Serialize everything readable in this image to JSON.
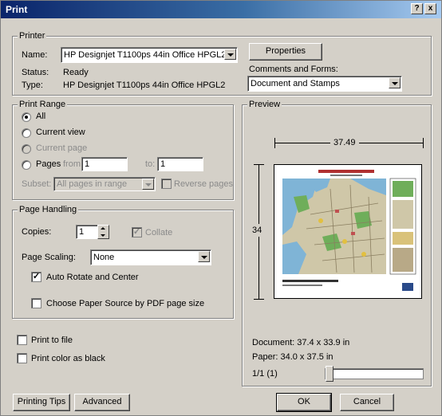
{
  "window": {
    "title": "Print",
    "help_btn": "?",
    "close_btn": "x"
  },
  "printer": {
    "legend": "Printer",
    "name_label": "Name:",
    "name_value": "HP Designjet T1100ps 44in Office HPGL2",
    "status_label": "Status:",
    "status_value": "Ready",
    "type_label": "Type:",
    "type_value": "HP Designjet T1100ps 44in Office HPGL2",
    "properties_btn": "Properties",
    "comments_label": "Comments and Forms:",
    "comments_value": "Document and Stamps"
  },
  "print_range": {
    "legend": "Print Range",
    "all": "All",
    "current_view": "Current view",
    "current_page": "Current page",
    "pages": "Pages",
    "from_label": "from:",
    "from_value": "1",
    "to_label": "to:",
    "to_value": "1",
    "subset_label": "Subset:",
    "subset_value": "All pages in range",
    "reverse_pages": "Reverse pages"
  },
  "page_handling": {
    "legend": "Page Handling",
    "copies_label": "Copies:",
    "copies_value": "1",
    "collate": "Collate",
    "scaling_label": "Page Scaling:",
    "scaling_value": "None",
    "auto_rotate": "Auto Rotate and Center",
    "choose_paper": "Choose Paper Source by PDF page size"
  },
  "options": {
    "print_to_file": "Print to file",
    "print_color_black": "Print color as black"
  },
  "preview": {
    "legend": "Preview",
    "width_label": "37.49",
    "height_label": "34",
    "document_size": "Document: 37.4 x 33.9 in",
    "paper_size": "Paper: 34.0 x 37.5 in",
    "page_counter": "1/1 (1)"
  },
  "buttons": {
    "printing_tips": "Printing Tips",
    "advanced": "Advanced",
    "ok": "OK",
    "cancel": "Cancel"
  },
  "colors": {
    "title_bar": "#0a246a",
    "dialog_bg": "#d4d0c8",
    "map_water": "#7fb4d6",
    "map_land": "#cfc7a8",
    "map_green": "#6fae5a"
  }
}
